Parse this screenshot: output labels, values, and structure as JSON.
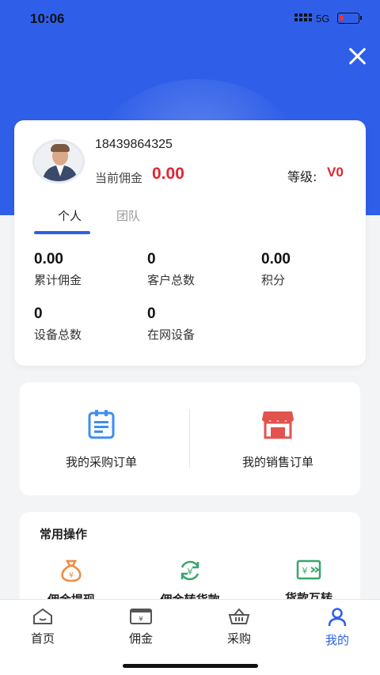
{
  "status_bar": {
    "time": "10:06",
    "network": "5G"
  },
  "profile": {
    "phone": "18439864325",
    "commission_label": "当前佣金",
    "commission_value": "0.00",
    "level_label": "等级:",
    "level_value": "V0"
  },
  "tabs": [
    {
      "label": "个人",
      "active": true
    },
    {
      "label": "团队",
      "active": false
    }
  ],
  "stats": [
    {
      "value": "0.00",
      "label": "累计佣金"
    },
    {
      "value": "0",
      "label": "客户总数"
    },
    {
      "value": "0.00",
      "label": "积分"
    },
    {
      "value": "0",
      "label": "设备总数"
    },
    {
      "value": "0",
      "label": "在网设备"
    }
  ],
  "orders": [
    {
      "label": "我的采购订单",
      "icon": "clipboard-icon"
    },
    {
      "label": "我的销售订单",
      "icon": "store-icon"
    }
  ],
  "operations": {
    "title": "常用操作",
    "items": [
      {
        "label": "佣金提现",
        "icon": "money-bag-icon"
      },
      {
        "label": "佣金转货款",
        "icon": "yuan-exchange-icon"
      },
      {
        "label": "货款互转",
        "icon": "transfer-icon"
      }
    ]
  },
  "nav": [
    {
      "label": "首页",
      "icon": "home-icon",
      "active": false
    },
    {
      "label": "佣金",
      "icon": "wallet-icon",
      "active": false
    },
    {
      "label": "采购",
      "icon": "basket-icon",
      "active": false
    },
    {
      "label": "我的",
      "icon": "user-icon",
      "active": true
    }
  ],
  "colors": {
    "primary": "#2f5fe8",
    "accent_red": "#e0262f",
    "order_blue": "#3e8ef0",
    "order_red": "#e2534e",
    "op_orange": "#f08a3c",
    "op_green": "#3aa56b"
  }
}
